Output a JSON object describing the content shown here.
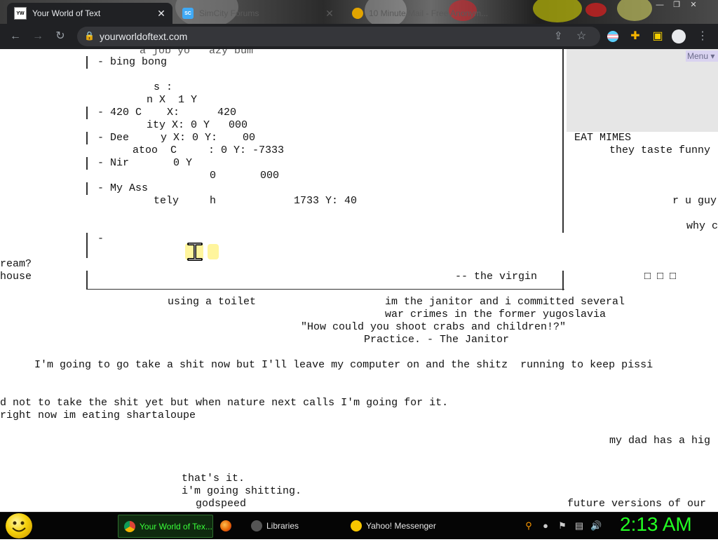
{
  "browser": {
    "tabs": [
      {
        "title": "Your World of Text",
        "favicon": "yw-icon",
        "active": true
      },
      {
        "title": "SimCity Forums",
        "favicon": "simcity-icon",
        "active": false
      },
      {
        "title": "10 Minute Mail - Free Anonym...",
        "favicon": "mail-icon",
        "active": false
      }
    ],
    "url": "yourworldoftext.com",
    "close_glyph": "✕"
  },
  "page": {
    "menu_label": "Menu",
    "lines": [
      {
        "text": "a job yo   azy bum"
      },
      {
        "text": "- bing bong"
      },
      {
        "text": "s :"
      },
      {
        "text": "n X  1 Y"
      },
      {
        "text": "- 420 C    X:      420"
      },
      {
        "text": "ity X: 0 Y   000"
      },
      {
        "text": "- Dee     y X: 0 Y:    00"
      },
      {
        "text": "atoo  C     : 0 Y: -7333"
      },
      {
        "text": "- Nir       0 Y"
      },
      {
        "text": "0       000"
      },
      {
        "text": "- My Ass"
      },
      {
        "text": "tely"
      },
      {
        "text": "h"
      },
      {
        "text": "1733 Y: 40"
      },
      {
        "text": "-"
      },
      {
        "text": "ream?"
      },
      {
        "text": "house"
      },
      {
        "text": "-- the virgin"
      },
      {
        "text": "EAT MIMES"
      },
      {
        "text": "they taste funny"
      },
      {
        "text": "r u guy"
      },
      {
        "text": "why c"
      },
      {
        "text": "□ □ □"
      },
      {
        "text": "using a toilet"
      },
      {
        "text": "im the janitor and i committed several"
      },
      {
        "text": "war crimes in the former yugoslavia"
      },
      {
        "text": "\"How could you shoot crabs and children!?\""
      },
      {
        "text": "Practice. - The Janitor"
      },
      {
        "text": "I'm going to go take a shit now but I'll leave my computer on and the shitz  running to keep pissi"
      },
      {
        "text": "d not to take the shit yet but when nature next calls I'm going for it."
      },
      {
        "text": "right now im eating shartaloupe"
      },
      {
        "text": "my dad has a hig"
      },
      {
        "text": "that's it."
      },
      {
        "text": "i'm going shitting."
      },
      {
        "text": "godspeed"
      },
      {
        "text": "future versions of our"
      }
    ]
  },
  "taskbar": {
    "tasks": [
      {
        "label": "Your World of Tex...",
        "icon": "chrome-icon",
        "active": true
      },
      {
        "label": "",
        "icon": "firefox-icon",
        "active": false
      },
      {
        "label": "Libraries",
        "icon": "libraries-icon",
        "active": false
      },
      {
        "label": "Yahoo! Messenger",
        "icon": "yahoo-messenger-icon",
        "active": false
      }
    ],
    "clock": "2:13 AM"
  },
  "colors": {
    "browser_toolbar": "#202124",
    "clock": "#22ff22",
    "highlight": "#fff59d",
    "menu_button": "#d9d3f0"
  }
}
